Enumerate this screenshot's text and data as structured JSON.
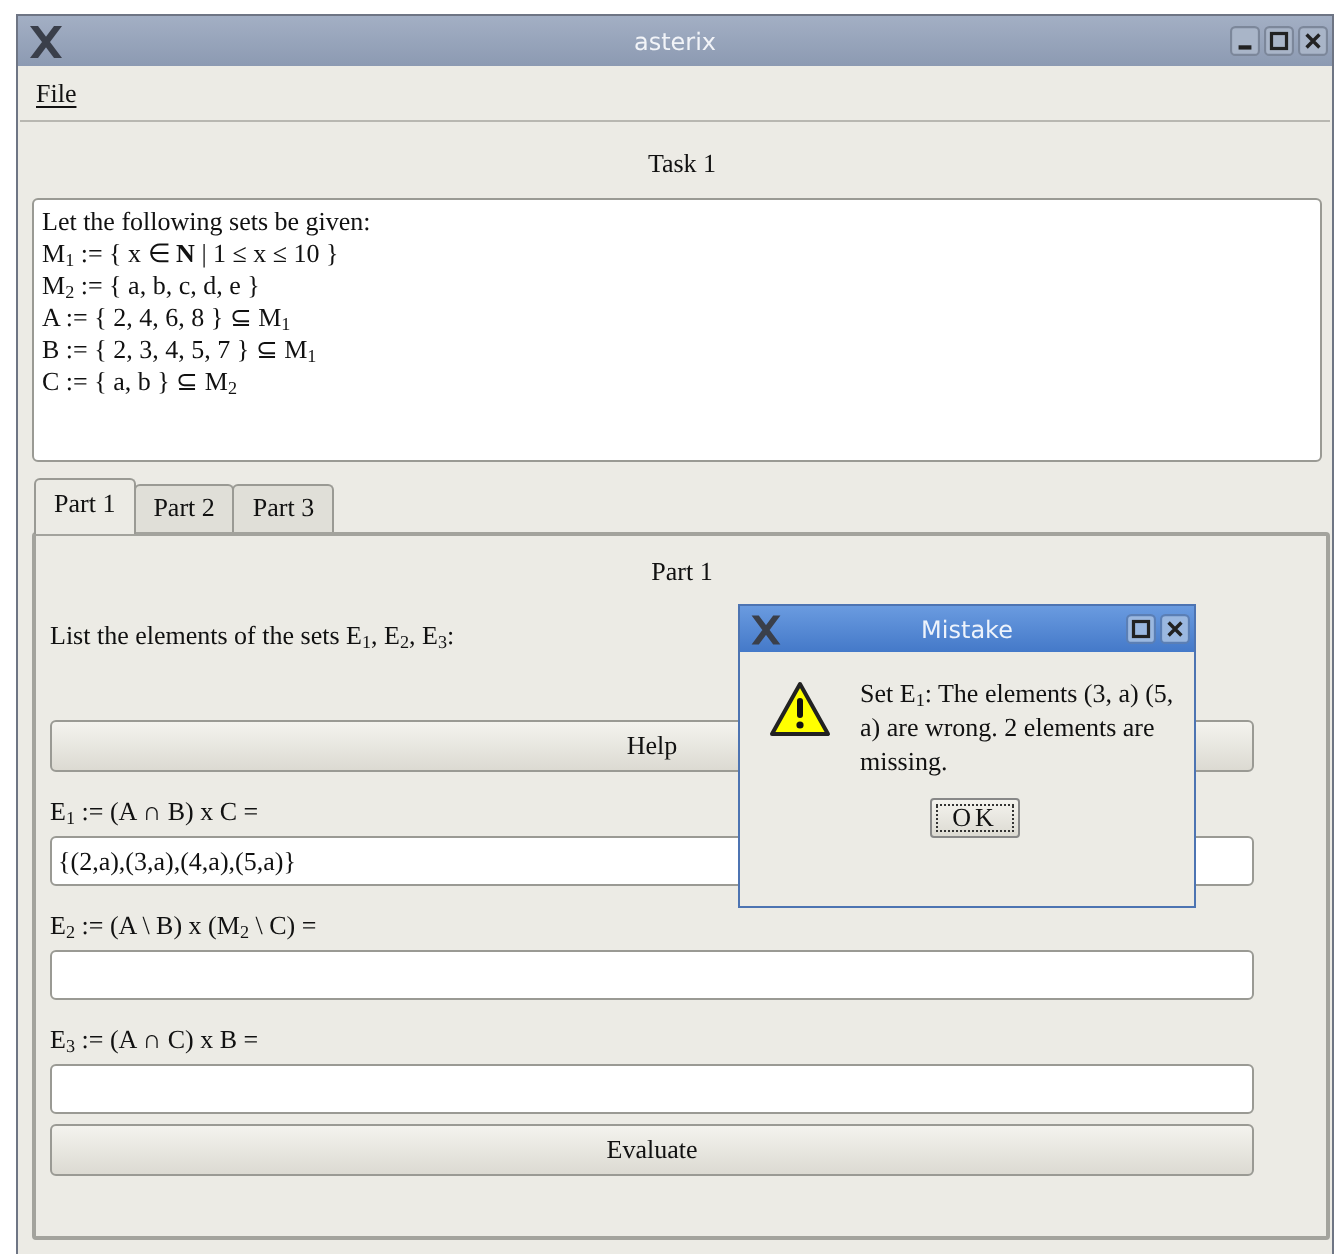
{
  "window": {
    "title": "asterix"
  },
  "menu": [
    {
      "label": "File"
    }
  ],
  "task": {
    "title": "Task 1",
    "lines": [
      "Let the following sets be given:",
      "M$_{1}$ := { x ∈ **N** | 1 ≤ x ≤ 10 }",
      "M$_{2}$ := { a, b, c, d, e }",
      "A := { 2, 4, 6, 8 } ⊆ M$_{1}$",
      "B := { 2, 3, 4, 5, 7 } ⊆ M$_{1}$",
      "C := { a, b } ⊆ M$_{2}$"
    ]
  },
  "tabs": [
    {
      "label": "Part 1",
      "selected": true
    },
    {
      "label": "Part 2",
      "selected": false
    },
    {
      "label": "Part 3",
      "selected": false
    }
  ],
  "part": {
    "title": "Part 1",
    "instruction": "List the elements of the sets E$_{1}$, E$_{2}$, E$_{3}$:",
    "help_button": "Help",
    "questions": [
      {
        "label": "E$_{1}$ := (A ∩ B) x C =",
        "value": "{(2,a),(3,a),(4,a),(5,a)}"
      },
      {
        "label": "E$_{2}$ := (A \\ B) x (M$_{2}$ \\ C) ="
      },
      {
        "label": "E$_{3}$ := (A ∩ C) x B ="
      }
    ],
    "evaluate_button": "Evaluate"
  },
  "dialog": {
    "title": "Mistake",
    "message": "Set E$_{1}$: The elements (3, a) (5, a) are wrong. 2 elements are missing.",
    "ok_button": "OK"
  }
}
